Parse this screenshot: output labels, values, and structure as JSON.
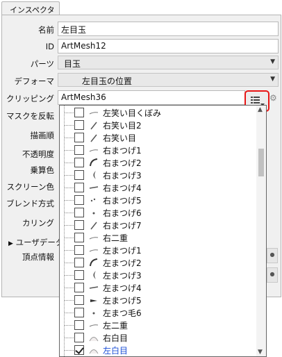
{
  "tab": {
    "label": "インスペクタ"
  },
  "props": {
    "name_label": "名前",
    "name_value": "左目玉",
    "id_label": "ID",
    "id_value": "ArtMesh12",
    "parts_label": "パーツ",
    "parts_value": "目玉",
    "deformer_label": "デフォーマ",
    "deformer_value": "左目玉の位置",
    "clipping_label": "クリッピング",
    "clipping_value": "ArtMesh36",
    "mask_invert_label": "マスクを反転",
    "draw_order_label": "描画順",
    "opacity_label": "不透明度",
    "multiply_label": "乗算色",
    "screen_label": "スクリーン色",
    "blend_label": "ブレンド方式",
    "culling_label": "カリング",
    "userdata_label": "ユーザデータ",
    "vertex_label": "頂点情報"
  },
  "dropdown": {
    "items": [
      {
        "label": "左笑い目くぼみ",
        "checked": false,
        "selected": false,
        "icon": "thin-stroke"
      },
      {
        "label": "右笑い目2",
        "checked": false,
        "selected": false,
        "icon": "slash"
      },
      {
        "label": "右笑い目",
        "checked": false,
        "selected": false,
        "icon": "slash"
      },
      {
        "label": "右まつげ1",
        "checked": false,
        "selected": false,
        "icon": "thin-stroke"
      },
      {
        "label": "右まつげ2",
        "checked": false,
        "selected": false,
        "icon": "arc"
      },
      {
        "label": "右まつげ3",
        "checked": false,
        "selected": false,
        "icon": "crescent"
      },
      {
        "label": "右まつげ4",
        "checked": false,
        "selected": false,
        "icon": "dash"
      },
      {
        "label": "右まつげ5",
        "checked": false,
        "selected": false,
        "icon": "dots"
      },
      {
        "label": "右まつげ6",
        "checked": false,
        "selected": false,
        "icon": "small-dot"
      },
      {
        "label": "右まつげ7",
        "checked": false,
        "selected": false,
        "icon": "slash"
      },
      {
        "label": "右二重",
        "checked": false,
        "selected": false,
        "icon": "thin-stroke"
      },
      {
        "label": "左まつげ1",
        "checked": false,
        "selected": false,
        "icon": "thin-stroke"
      },
      {
        "label": "左まつげ2",
        "checked": false,
        "selected": false,
        "icon": "arc"
      },
      {
        "label": "左まつげ3",
        "checked": false,
        "selected": false,
        "icon": "crescent"
      },
      {
        "label": "左まつげ4",
        "checked": false,
        "selected": false,
        "icon": "dash"
      },
      {
        "label": "左まつげ5",
        "checked": false,
        "selected": false,
        "icon": "wedge"
      },
      {
        "label": "左まつ毛6",
        "checked": false,
        "selected": false,
        "icon": "small-dot"
      },
      {
        "label": "左二重",
        "checked": false,
        "selected": false,
        "icon": "thin-stroke"
      },
      {
        "label": "右白目",
        "checked": false,
        "selected": false,
        "icon": "eye-white"
      },
      {
        "label": "左白目",
        "checked": true,
        "selected": true,
        "icon": "eye-white"
      }
    ]
  },
  "colors": {
    "highlight": "#e81515",
    "selected_text": "#1c4fd6",
    "panel_bg": "#f0f0f0"
  }
}
